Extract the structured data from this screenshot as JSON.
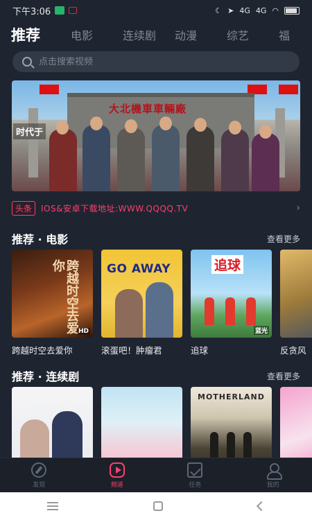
{
  "status_bar": {
    "time": "下午3:06",
    "signal1": "4G",
    "signal2": "4G"
  },
  "tabs": [
    {
      "label": "推荐",
      "active": true
    },
    {
      "label": "电影"
    },
    {
      "label": "连续剧"
    },
    {
      "label": "动漫"
    },
    {
      "label": "综艺"
    },
    {
      "label": "福"
    }
  ],
  "search": {
    "placeholder": "点击搜索视频"
  },
  "banner": {
    "sign": "大北機車車輛廠",
    "logo_text": "时代于"
  },
  "headline": {
    "badge": "头条",
    "text": "IOS&安卓下载地址:WWW.QQQQ.TV",
    "chevron": "›"
  },
  "sections": [
    {
      "title": "推荐 · 电影",
      "more": "查看更多",
      "items": [
        {
          "title": "跨越时空去爱你",
          "poster_text": "跨越时空去爱你",
          "badge": "HD"
        },
        {
          "title": "滚蛋吧！肿瘤君",
          "poster_text": "GO AWAY"
        },
        {
          "title": "追球",
          "poster_text": "追球",
          "badge": "蓝光"
        },
        {
          "title": "反贪风"
        }
      ]
    },
    {
      "title": "推荐 · 连续剧",
      "more": "查看更多",
      "items": [
        {
          "title": "",
          "poster_text": ""
        },
        {
          "title": "",
          "poster_text": ""
        },
        {
          "title": "",
          "poster_text": "MOTHERLAND"
        },
        {
          "title": ""
        }
      ]
    }
  ],
  "bottom_nav": [
    {
      "label": "发现",
      "icon": "compass-icon"
    },
    {
      "label": "频道",
      "icon": "play-icon",
      "active": true
    },
    {
      "label": "任务",
      "icon": "chart-icon"
    },
    {
      "label": "我的",
      "icon": "user-icon"
    }
  ],
  "colors": {
    "accent": "#ff3d6e",
    "background": "#1f2530"
  }
}
